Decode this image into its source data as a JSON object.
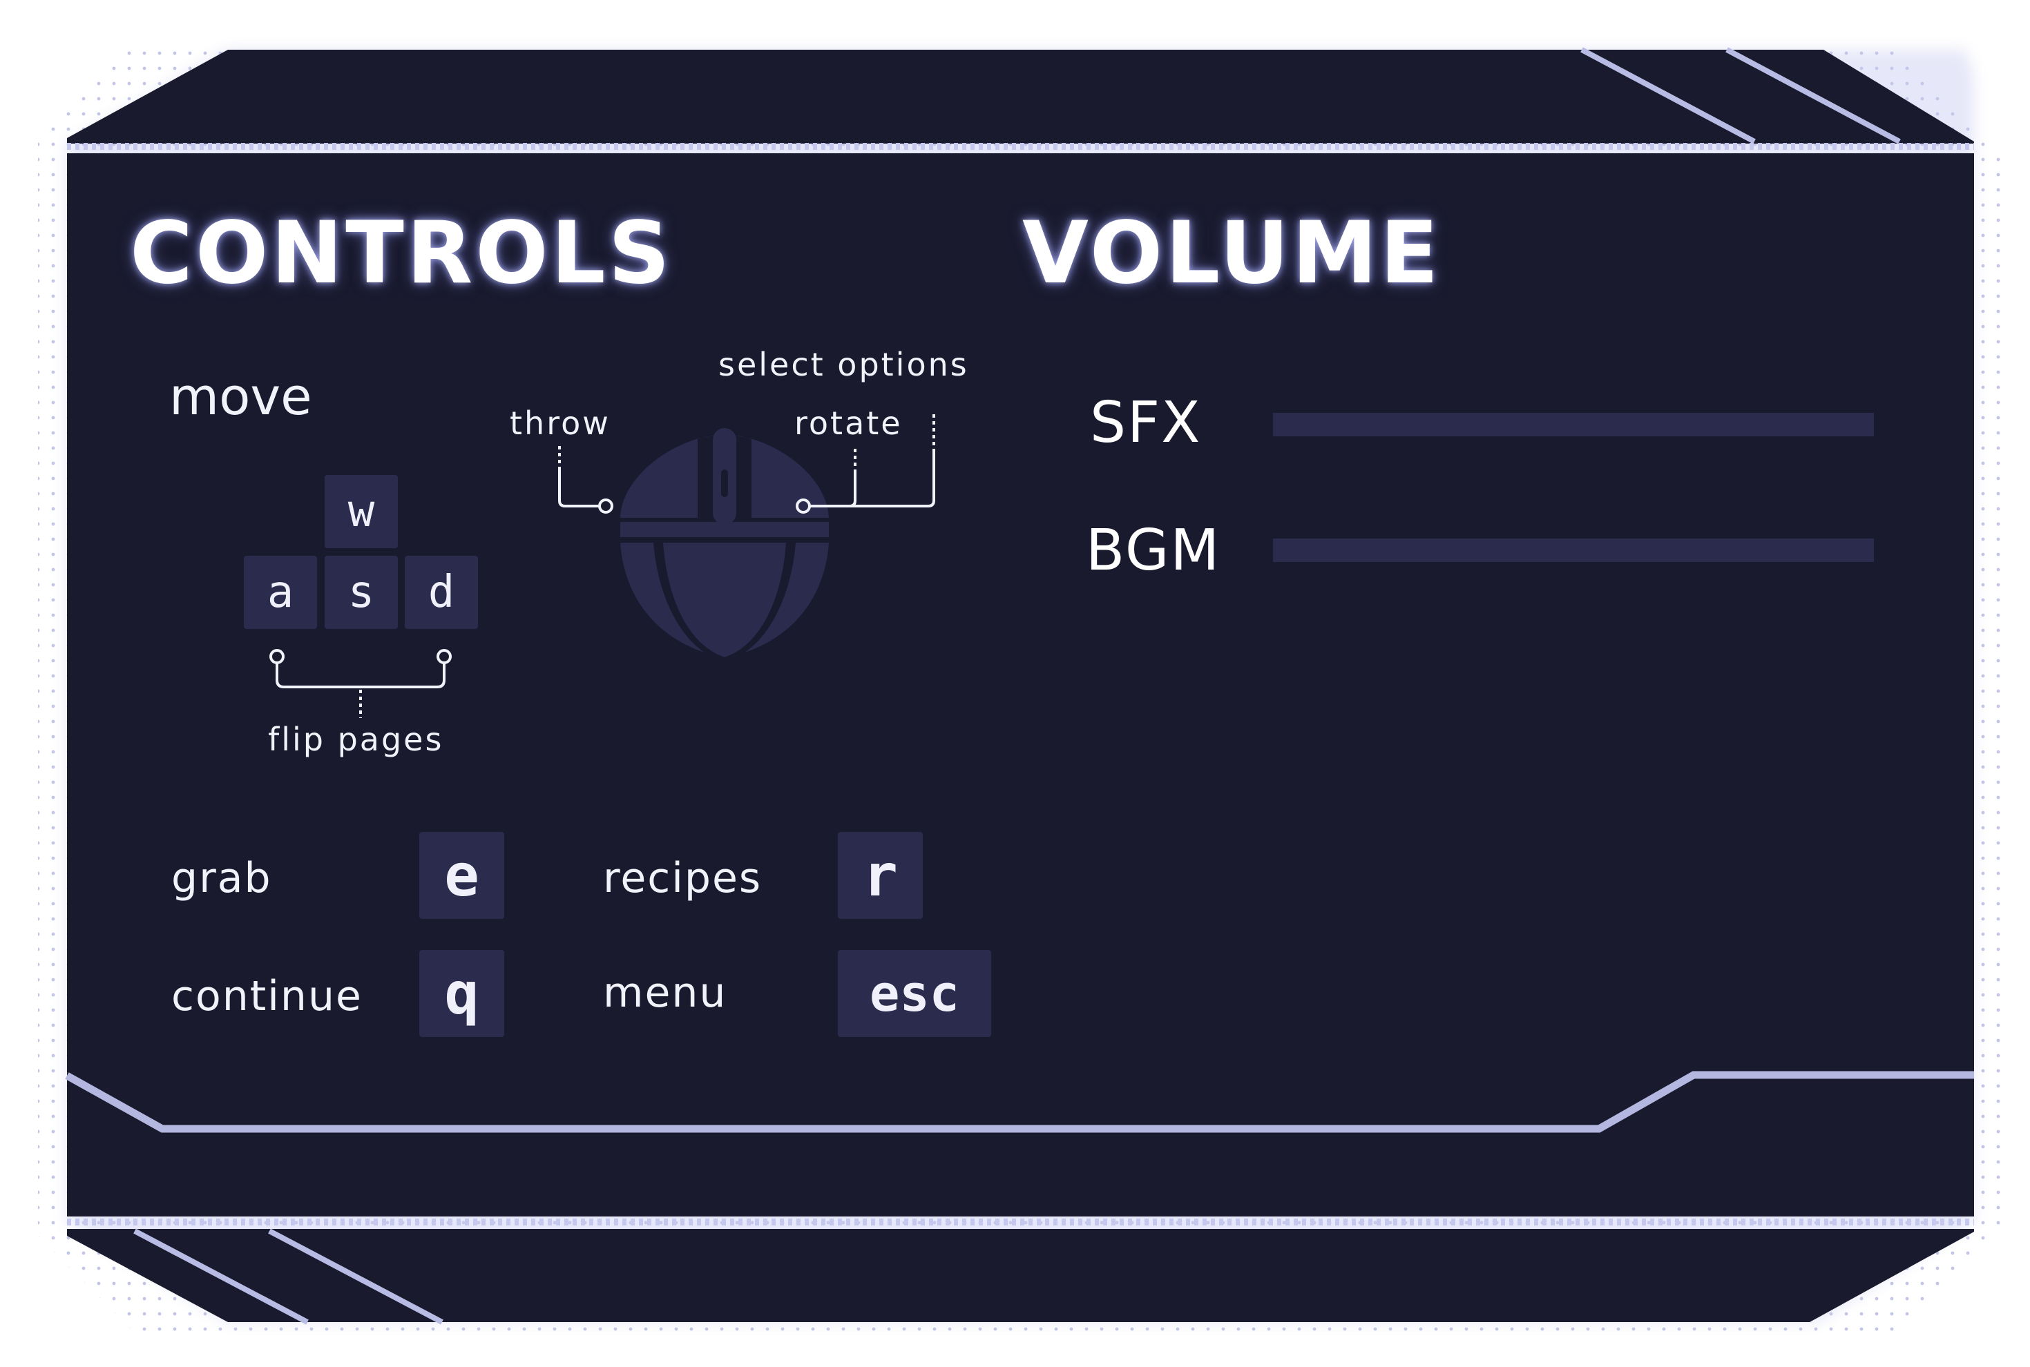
{
  "colors": {
    "panel": "#191a2e",
    "frame_line": "#b4b8e0",
    "key_bg": "#2a2b4d",
    "text": "#f4f4ff",
    "dots": "#a8acd8"
  },
  "controls": {
    "title": "CONTROLS",
    "move_label": "move",
    "keys": {
      "w": "w",
      "a": "a",
      "s": "s",
      "d": "d"
    },
    "flip_pages_label": "flip  pages",
    "mouse": {
      "throw_label": "throw",
      "rotate_label": "rotate",
      "select_options_label": "select  options",
      "icon": "mouse-icon"
    },
    "bindings": [
      {
        "label": "grab",
        "key": "e"
      },
      {
        "label": "recipes",
        "key": "r"
      },
      {
        "label": "continue",
        "key": "q"
      },
      {
        "label": "menu",
        "key": "esc"
      }
    ]
  },
  "volume": {
    "title": "VOLUME",
    "sliders": [
      {
        "label": "SFX",
        "level": 0
      },
      {
        "label": "BGM",
        "level": 0
      }
    ]
  }
}
